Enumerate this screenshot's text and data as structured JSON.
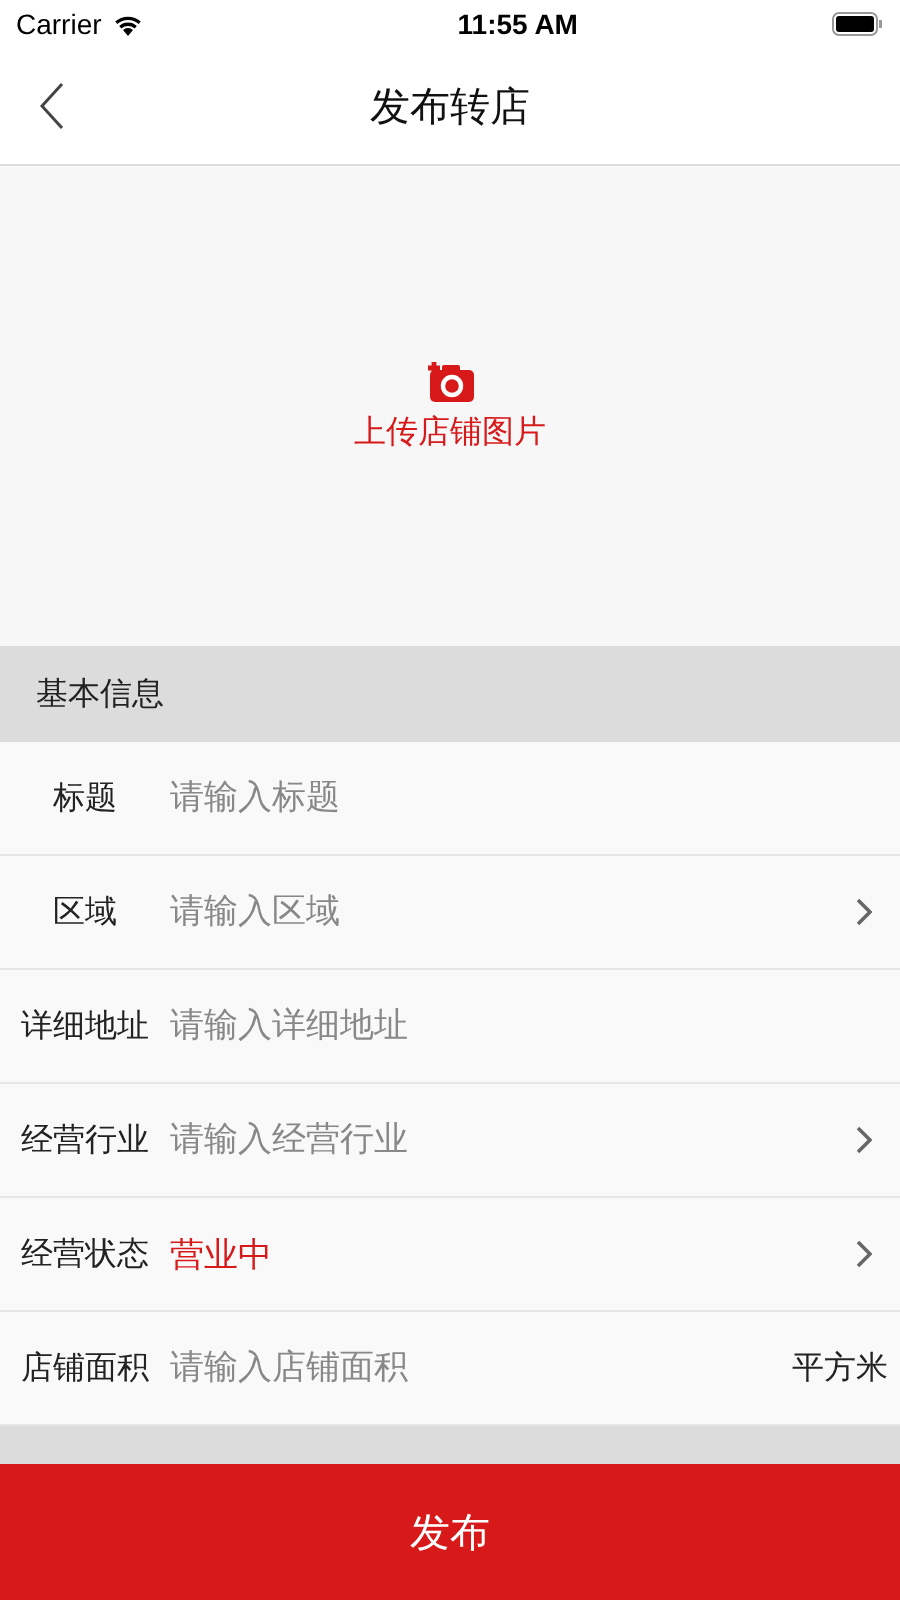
{
  "status_bar": {
    "carrier": "Carrier",
    "time": "11:55 AM"
  },
  "nav": {
    "title": "发布转店"
  },
  "upload": {
    "label": "上传店铺图片"
  },
  "section": {
    "title": "基本信息"
  },
  "rows": [
    {
      "kind": "input",
      "label": "标题",
      "placeholder": "请输入标题"
    },
    {
      "kind": "select",
      "label": "区域",
      "placeholder": "请输入区域"
    },
    {
      "kind": "input",
      "label": "详细地址",
      "placeholder": "请输入详细地址"
    },
    {
      "kind": "select",
      "label": "经营行业",
      "placeholder": "请输入经营行业"
    },
    {
      "kind": "select",
      "label": "经营状态",
      "value": "营业中"
    },
    {
      "kind": "input",
      "label": "店铺面积",
      "placeholder": "请输入店铺面积",
      "unit": "平方米"
    }
  ],
  "submit": {
    "label": "发布"
  }
}
